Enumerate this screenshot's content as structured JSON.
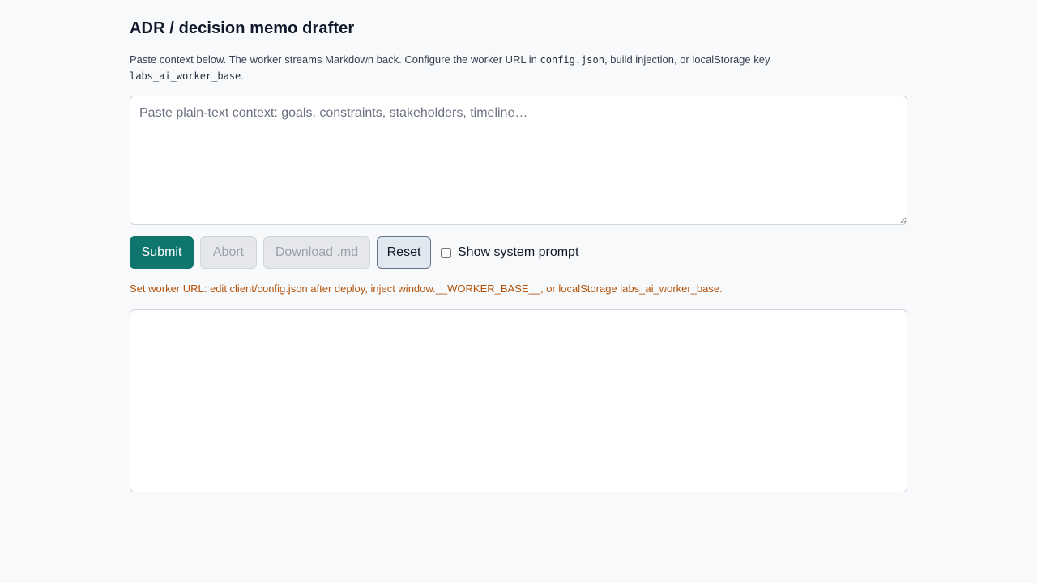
{
  "page": {
    "title": "ADR / decision memo drafter"
  },
  "description": {
    "text_1": "Paste context below. The worker streams Markdown back. Configure the worker URL in ",
    "code_1": "config.json",
    "text_2": ", build injection, or localStorage key ",
    "code_2": "labs_ai_worker_base",
    "text_3": "."
  },
  "context_input": {
    "placeholder": "Paste plain-text context: goals, constraints, stakeholders, timeline…",
    "value": ""
  },
  "toolbar": {
    "submit_label": "Submit",
    "abort_label": "Abort",
    "download_label": "Download .md",
    "reset_label": "Reset",
    "show_system_prompt_label": "Show system prompt",
    "show_system_prompt_checked": false
  },
  "status": {
    "warning": "Set worker URL: edit client/config.json after deploy, inject window.__WORKER_BASE__, or localStorage labs_ai_worker_base."
  },
  "output": {
    "text": ""
  },
  "colors": {
    "background": "#f8f9fb",
    "primary": "#0f766e",
    "warning": "#b45309",
    "border": "#d1d5db"
  }
}
